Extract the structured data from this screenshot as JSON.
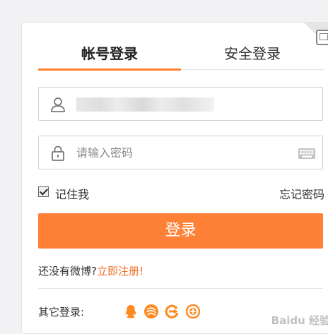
{
  "tabs": {
    "account_login": "帐号登录",
    "secure_login": "安全登录"
  },
  "username": {
    "value": "",
    "placeholder": ""
  },
  "password": {
    "value": "",
    "placeholder": "请输入密码"
  },
  "remember": {
    "label": "记住我",
    "checked": true
  },
  "forgot_password": "忘记密码",
  "login_button": "登录",
  "register": {
    "prompt": "还没有微博?",
    "link": "立即注册!"
  },
  "other_login": {
    "label": "其它登录:",
    "icons": [
      "qq-icon",
      "weibo-circle-icon",
      "tianyi-icon",
      "plus-circle-icon"
    ]
  },
  "watermark": "Baidu 经验",
  "colors": {
    "accent": "#ff8137",
    "link": "#f06b25",
    "tab_underline": "#ff7e2d",
    "icon_orange": "#ff8a1f"
  }
}
